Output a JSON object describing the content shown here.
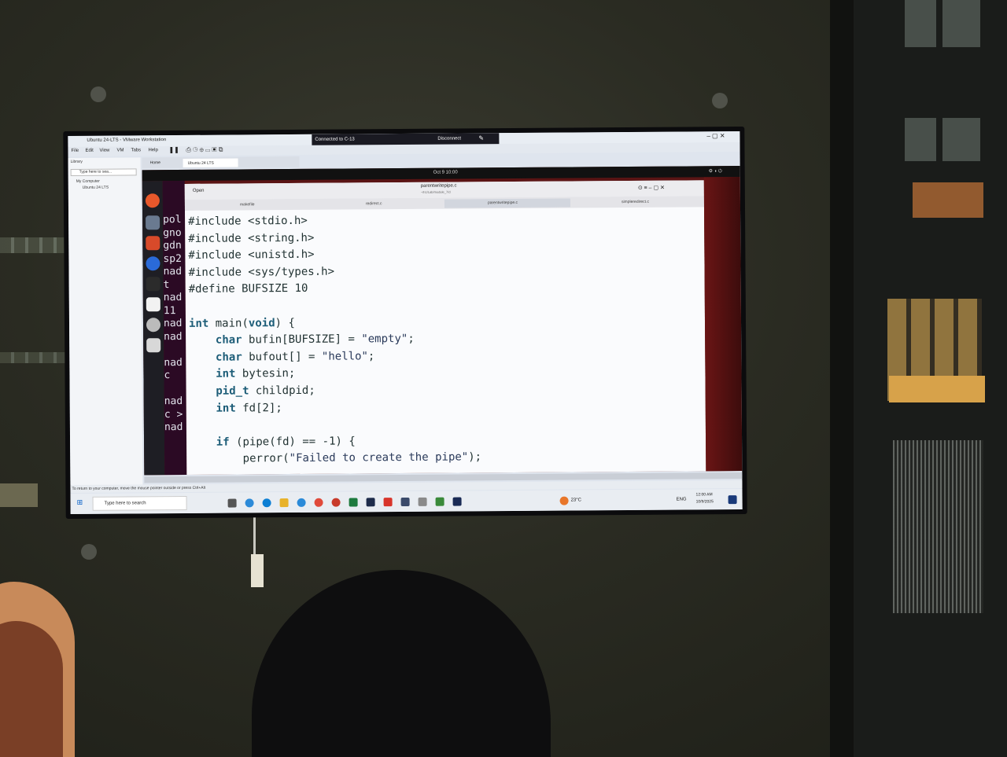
{
  "vmware": {
    "window_title": "Ubuntu 24-LTS - VMware Workstation",
    "menu": [
      "File",
      "Edit",
      "View",
      "VM",
      "Tabs",
      "Help"
    ],
    "connection": "Connected to C-13",
    "disconnect": "Disconnect",
    "library_label": "Library",
    "library_search_placeholder": "Type here to sea...",
    "tree_root": "My Computer",
    "tree_vm": "Ubuntu 24 LTS",
    "tab_home": "Home",
    "tab_vm": "Ubuntu 24 LTS",
    "status_message": "To return to your computer, move the mouse pointer outside or press Ctrl+Alt"
  },
  "ubuntu": {
    "clock": "Oct 9 10:00"
  },
  "editor": {
    "open_label": "Open",
    "file_title": "parentwritepipe.c",
    "file_subtitle": "~/h1/Lab/module_7/d",
    "tabs": [
      "makefile",
      "redirect.c",
      "parentwritepipe.c",
      "simpleredirect.c"
    ],
    "code_lines": [
      "#include <stdio.h>",
      "#include <string.h>",
      "#include <unistd.h>",
      "#include <sys/types.h>",
      "#define BUFSIZE 10",
      "",
      "int main(void) {",
      "    char bufin[BUFSIZE] = \"empty\";",
      "    char bufout[] = \"hello\";",
      "    int bytesin;",
      "    pid_t childpid;",
      "    int fd[2];",
      "",
      "    if (pipe(fd) == -1) {",
      "        perror(\"Failed to create the pipe\");"
    ]
  },
  "terminal": {
    "lines": [
      "pol",
      "gno",
      "gdn",
      "sp2",
      "nad",
      "t",
      "nad",
      " 11",
      "nad",
      "nad",
      "",
      "nad",
      "c",
      "",
      "nad",
      "c >",
      "nad"
    ]
  },
  "windows_taskbar": {
    "search_placeholder": "Type here to search",
    "weather": "23°C",
    "language": "ENG",
    "time": "12:00 AM",
    "date": "10/9/2025"
  },
  "colors": {
    "ubuntu_bg": "#5a1414",
    "terminal_bg": "#2b0a24",
    "keyword": "#1d5d78"
  }
}
